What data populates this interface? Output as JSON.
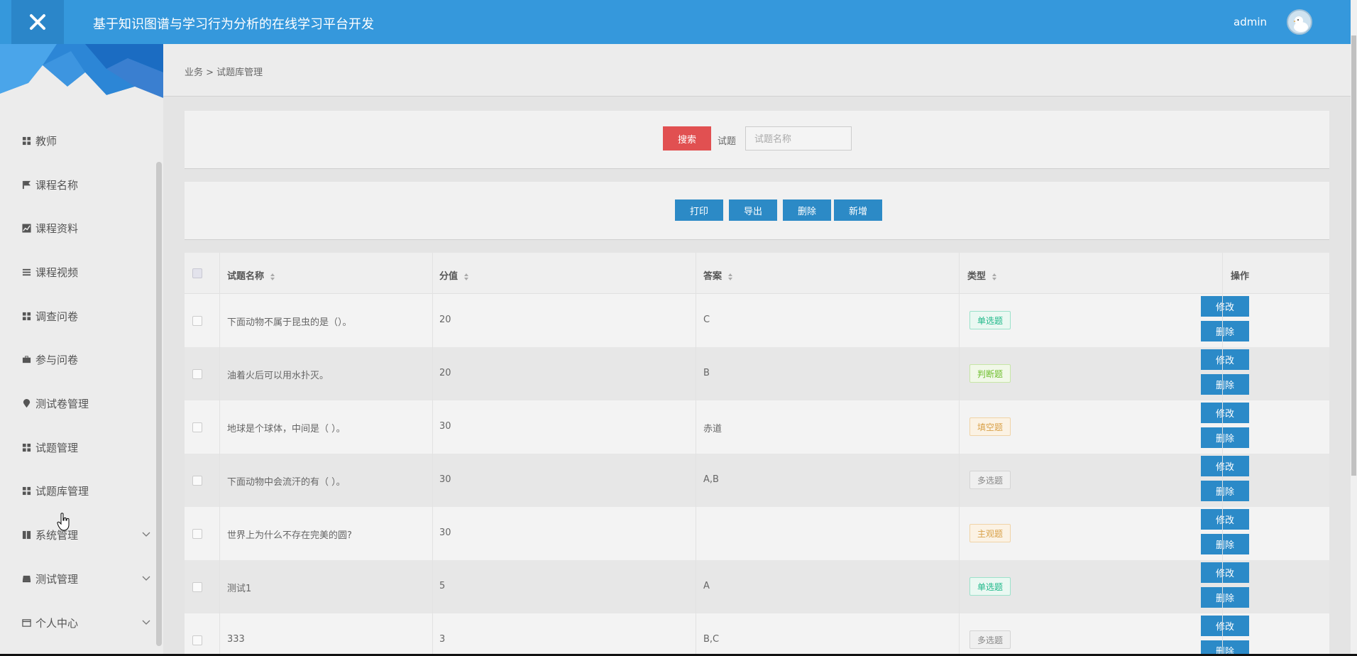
{
  "header": {
    "title": "基于知识图谱与学习行为分析的在线学习平台开发",
    "user": "admin"
  },
  "sidebar": {
    "items": [
      {
        "label": "教师",
        "icon": "grid-icon"
      },
      {
        "label": "课程名称",
        "icon": "flag-icon"
      },
      {
        "label": "课程资料",
        "icon": "chart-icon"
      },
      {
        "label": "课程视频",
        "icon": "list-icon"
      },
      {
        "label": "调查问卷",
        "icon": "grid-icon"
      },
      {
        "label": "参与问卷",
        "icon": "briefcase-icon"
      },
      {
        "label": "测试卷管理",
        "icon": "map-pin-icon"
      },
      {
        "label": "试题管理",
        "icon": "grid-icon"
      },
      {
        "label": "试题库管理",
        "icon": "grid-icon"
      },
      {
        "label": "系统管理",
        "icon": "book-icon",
        "expandable": true
      },
      {
        "label": "测试管理",
        "icon": "tray-icon",
        "expandable": true
      },
      {
        "label": "个人中心",
        "icon": "id-card-icon",
        "expandable": true
      }
    ]
  },
  "breadcrumb": "业务 > 试题库管理",
  "search": {
    "button": "搜索",
    "label": "试题",
    "placeholder": "试题名称"
  },
  "toolbar": {
    "print": "打印",
    "export": "导出",
    "delete": "删除",
    "add": "新增"
  },
  "table": {
    "columns": [
      "试题名称",
      "分值",
      "答案",
      "类型",
      "操作"
    ],
    "actions": {
      "edit": "修改",
      "delete": "删除"
    },
    "rows": [
      {
        "name": "下面动物不属于昆虫的是（）。",
        "score": "20",
        "answer": "C",
        "type": "单选题"
      },
      {
        "name": "油着火后可以用水扑灭。",
        "score": "20",
        "answer": "B",
        "type": "判断题"
      },
      {
        "name": "地球是个球体，中间是（ ）。",
        "score": "30",
        "answer": "赤道",
        "type": "填空题"
      },
      {
        "name": "下面动物中会流汗的有（ ）。",
        "score": "30",
        "answer": "A,B",
        "type": "多选题"
      },
      {
        "name": "世界上为什么不存在完美的圆?",
        "score": "30",
        "answer": "",
        "type": "主观题"
      },
      {
        "name": "测试1",
        "score": "5",
        "answer": "A",
        "type": "单选题"
      },
      {
        "name": "333",
        "score": "3",
        "answer": "B,C",
        "type": "多选题"
      }
    ]
  },
  "colors": {
    "header": "#3598dc",
    "primary_button": "#2c8ac6",
    "search_button": "#e15051",
    "tag_single": "#1fb88a",
    "tag_judge": "#6fbf2e",
    "tag_fill": "#d9a24a",
    "tag_multi": "#888888",
    "tag_subjective": "#d9a24a"
  }
}
